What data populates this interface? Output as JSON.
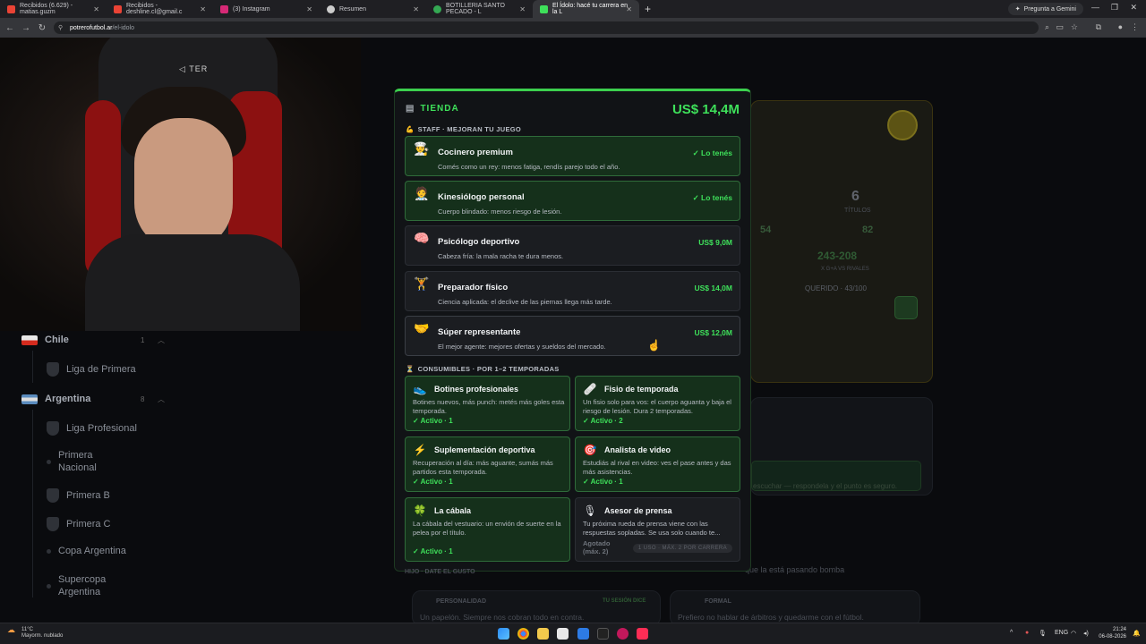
{
  "browser": {
    "tabs": [
      {
        "label": "Recibidos (6.629) - matias.guzm",
        "favcolor": "#ea4335"
      },
      {
        "label": "Recibidos - deshline.cl@gmail.c",
        "favcolor": "#ea4335"
      },
      {
        "label": "(3) Instagram",
        "favcolor": "#d62976"
      },
      {
        "label": "Resumen",
        "favcolor": "#cccccc"
      },
      {
        "label": "BOTILLERIA SANTO PECADO - L",
        "favcolor": "#34a853"
      },
      {
        "label": "El Ídolo: hacé tu carrera en la L",
        "favcolor": "#3ee05a"
      }
    ],
    "gemini_label": "Pregunta a Gemini",
    "url_host": "potrerofutbol.ar",
    "url_path": "/el-idolo"
  },
  "sidebar": {
    "items": [
      {
        "label": "Chile",
        "type": "country",
        "count": "1"
      },
      {
        "label": "Liga de Primera",
        "type": "league"
      },
      {
        "label": "Argentina",
        "type": "country",
        "count": "8"
      },
      {
        "label": "Liga Profesional",
        "type": "league"
      },
      {
        "label": "Primera Nacional",
        "type": "league"
      },
      {
        "label": "Primera B",
        "type": "league"
      },
      {
        "label": "Primera C",
        "type": "league"
      },
      {
        "label": "Copa Argentina",
        "type": "league"
      },
      {
        "label": "Supercopa Argentina",
        "type": "league"
      }
    ]
  },
  "background": {
    "titles_value": "6",
    "titles_label": "TÍTULOS",
    "stat1": "54",
    "stat2": "82",
    "record": "243-208",
    "vs_label": "X G+A VS RIVALES",
    "querido": "QUERIDO · 43/100",
    "bg_line1": "escuchar — respondela y el punto es seguro.",
    "bg_line2": "que la está pasando bomba",
    "personalidad": "PERSONALIDAD",
    "tu_sesion": "TU SESIÓN DICE",
    "formal": "FORMAL",
    "bg_line3": "Un papelón. Siempre nos cobran todo en contra.",
    "bg_line4": "Prefiero no hablar de árbitros y quedarme con el fútbol.",
    "hijo_label": "HIJO · DATE EL GUSTO"
  },
  "shop": {
    "title": "TIENDA",
    "balance": "US$ 14,4M",
    "staff_title": "STAFF · MEJORAN TU JUEGO",
    "staff": [
      {
        "icon": "chef-icon",
        "glyph": "👨‍🍳",
        "name": "Cocinero premium",
        "desc": "Comés como un rey: menos fatiga, rendís parejo todo el año.",
        "price": "✓ Lo tenés",
        "owned": true
      },
      {
        "icon": "physio-icon",
        "glyph": "🧑‍⚕️",
        "name": "Kinesiólogo personal",
        "desc": "Cuerpo blindado: menos riesgo de lesión.",
        "price": "✓ Lo tenés",
        "owned": true
      },
      {
        "icon": "brain-icon",
        "glyph": "🧠",
        "name": "Psicólogo deportivo",
        "desc": "Cabeza fría: la mala racha te dura menos.",
        "price": "US$ 9,0M",
        "owned": false
      },
      {
        "icon": "weightlifter-icon",
        "glyph": "🏋",
        "name": "Preparador físico",
        "desc": "Ciencia aplicada: el declive de las piernas llega más tarde.",
        "price": "US$ 14,0M",
        "owned": false
      },
      {
        "icon": "handshake-icon",
        "glyph": "🤝",
        "name": "Súper representante",
        "desc": "El mejor agente: mejores ofertas y sueldos del mercado.",
        "price": "US$ 12,0M",
        "owned": false
      }
    ],
    "consumables_title": "CONSUMIBLES · POR 1–2 TEMPORADAS",
    "consumables": [
      {
        "icon": "boot-icon",
        "glyph": "👟",
        "name": "Botines profesionales",
        "desc": "Botines nuevos, más punch: metés más goles esta temporada.",
        "status": "✓ Activo · 1"
      },
      {
        "icon": "bandage-icon",
        "glyph": "🩹",
        "name": "Fisio de temporada",
        "desc": "Un fisio solo para vos: el cuerpo aguanta y baja el riesgo de lesión. Dura 2 temporadas.",
        "status": "✓ Activo · 2"
      },
      {
        "icon": "lightning-icon",
        "glyph": "⚡",
        "name": "Suplementación deportiva",
        "desc": "Recuperación al día: más aguante, sumás más partidos esta temporada.",
        "status": "✓ Activo · 1"
      },
      {
        "icon": "target-icon",
        "glyph": "🎯",
        "name": "Analista de video",
        "desc": "Estudiás al rival en video: ves el pase antes y das más asistencias.",
        "status": "✓ Activo · 1"
      },
      {
        "icon": "clover-icon",
        "glyph": "🍀",
        "name": "La cábala",
        "desc": "La cábala del vestuario: un envión de suerte en la pelea por el título.",
        "status": "✓ Activo · 1"
      },
      {
        "icon": "microphone-icon",
        "glyph": "🎙",
        "name": "Asesor de prensa",
        "desc": "Tu próxima rueda de prensa viene con las respuestas sopladas. Se usa solo cuando te...",
        "status": "Agotado (máx. 2)",
        "limit": "1 USO · MÁX. 2 POR CARRERA"
      }
    ]
  },
  "taskbar": {
    "temp": "11°C",
    "weather": "Mayorm. nublado",
    "lang": "ENG",
    "time": "21:24",
    "date": "06-08-2026"
  }
}
